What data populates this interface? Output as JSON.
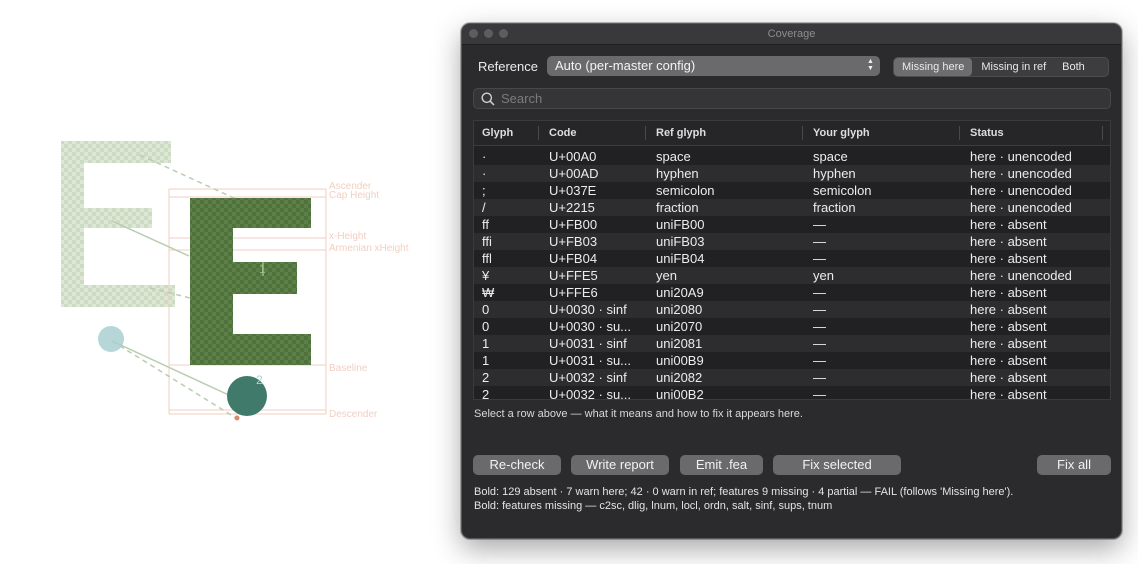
{
  "canvas": {
    "metric_labels": {
      "ascender": "Ascender",
      "cap_height": "Cap Height",
      "x_height": "x-Height",
      "armenian_xheight": "Armenian xHeight",
      "baseline": "Baseline",
      "descender": "Descender"
    },
    "node_label_1": "1",
    "node_label_2": "2"
  },
  "window": {
    "title": "Coverage",
    "reference_label": "Reference",
    "reference_value": "Auto (per-master config)",
    "segments": [
      {
        "label": "Missing here",
        "active": true
      },
      {
        "label": "Missing in ref",
        "active": false
      },
      {
        "label": "Both",
        "active": false
      }
    ],
    "search_placeholder": "Search",
    "columns": [
      "Glyph",
      "Code",
      "Ref glyph",
      "Your glyph",
      "Status"
    ],
    "rows": [
      {
        "glyph": "·",
        "code": "U+00A0",
        "ref": "space",
        "yours": "space",
        "status": "here · unencoded"
      },
      {
        "glyph": "·",
        "code": "U+00AD",
        "ref": "hyphen",
        "yours": "hyphen",
        "status": "here · unencoded"
      },
      {
        "glyph": ";",
        "code": "U+037E",
        "ref": "semicolon",
        "yours": "semicolon",
        "status": "here · unencoded"
      },
      {
        "glyph": "/",
        "code": "U+2215",
        "ref": "fraction",
        "yours": "fraction",
        "status": "here · unencoded"
      },
      {
        "glyph": "ff",
        "code": "U+FB00",
        "ref": "uniFB00",
        "yours": "—",
        "status": "here · absent"
      },
      {
        "glyph": "ffi",
        "code": "U+FB03",
        "ref": "uniFB03",
        "yours": "—",
        "status": "here · absent"
      },
      {
        "glyph": "ffl",
        "code": "U+FB04",
        "ref": "uniFB04",
        "yours": "—",
        "status": "here · absent"
      },
      {
        "glyph": "¥",
        "code": "U+FFE5",
        "ref": "yen",
        "yours": "yen",
        "status": "here · unencoded"
      },
      {
        "glyph": "₩",
        "code": "U+FFE6",
        "ref": "uni20A9",
        "yours": "—",
        "status": "here · absent"
      },
      {
        "glyph": "0",
        "code": "U+0030 · sinf",
        "ref": "uni2080",
        "yours": "—",
        "status": "here · absent"
      },
      {
        "glyph": "0",
        "code": "U+0030 · su...",
        "ref": "uni2070",
        "yours": "—",
        "status": "here · absent"
      },
      {
        "glyph": "1",
        "code": "U+0031 · sinf",
        "ref": "uni2081",
        "yours": "—",
        "status": "here · absent"
      },
      {
        "glyph": "1",
        "code": "U+0031 · su...",
        "ref": "uni00B9",
        "yours": "—",
        "status": "here · absent"
      },
      {
        "glyph": "2",
        "code": "U+0032 · sinf",
        "ref": "uni2082",
        "yours": "—",
        "status": "here · absent"
      },
      {
        "glyph": "2",
        "code": "U+0032 · su...",
        "ref": "uni00B2",
        "yours": "—",
        "status": "here · absent"
      }
    ],
    "hint": "Select a row above — what it means and how to fix it appears here.",
    "buttons": {
      "recheck": "Re-check",
      "write_report": "Write report",
      "emit_fea": "Emit .fea",
      "fix_selected": "Fix selected",
      "fix_all": "Fix all"
    },
    "summary_line1": "Bold: 129 absent · 7 warn here; 42 · 0 warn in ref; features 9 missing · 4 partial — FAIL (follows 'Missing here').",
    "summary_line2": "Bold: features missing — c2sc, dlig, lnum, locl, ordn, salt, sinf, sups, tnum"
  },
  "colors": {
    "window_bg": "#2b2b2d",
    "glyph_fill": "#5a7d45",
    "ref_glyph_fill": "#c8d8bc",
    "node_fill": "#3f7a6a",
    "metric_line": "#f2cfc3"
  }
}
